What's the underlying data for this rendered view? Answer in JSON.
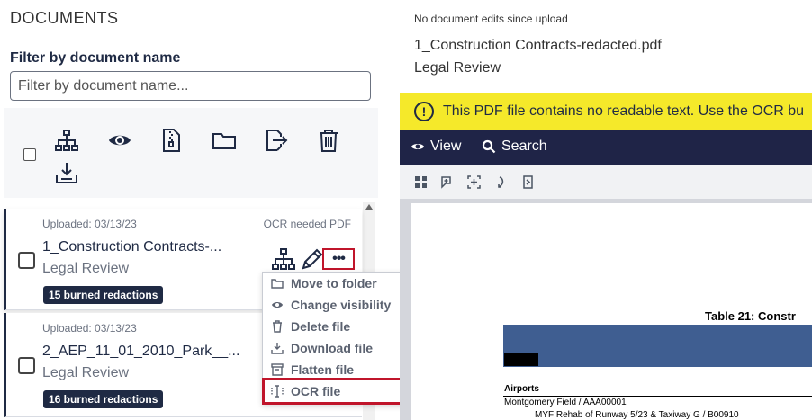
{
  "sidebar": {
    "title": "DOCUMENTS",
    "filter_label": "Filter by document name",
    "filter_placeholder": "Filter by document name...",
    "toolbar_icons": [
      "sitemap-icon",
      "eye-icon",
      "zip-file-icon",
      "folder-icon",
      "export-icon",
      "trash-icon",
      "download-icon"
    ]
  },
  "documents": [
    {
      "uploaded": "Uploaded: 03/13/23",
      "status": "OCR needed PDF",
      "name": "1_Construction Contracts-...",
      "folder": "Legal Review",
      "badge": "15 burned redactions"
    },
    {
      "uploaded": "Uploaded: 03/13/23",
      "name": "2_AEP_11_01_2010_Park__...",
      "folder": "Legal Review",
      "badge": "16 burned redactions"
    }
  ],
  "context_menu": {
    "items": [
      {
        "label": "Move to folder",
        "icon": "folder-icon"
      },
      {
        "label": "Change visibility",
        "icon": "eye-icon"
      },
      {
        "label": "Delete file",
        "icon": "trash-icon"
      },
      {
        "label": "Download file",
        "icon": "download-icon"
      },
      {
        "label": "Flatten file",
        "icon": "flatten-icon"
      },
      {
        "label": "OCR file",
        "icon": "text-cursor-icon"
      }
    ]
  },
  "viewer": {
    "edit_status": "No document edits since upload",
    "file_name": "1_Construction Contracts-redacted.pdf",
    "folder": "Legal Review",
    "warning": "This PDF file contains no readable text. Use the OCR bu",
    "tabs": [
      {
        "label": "View",
        "icon": "eye-icon"
      },
      {
        "label": "Search",
        "icon": "search-icon"
      }
    ],
    "tools": [
      "grid-icon",
      "zoom-icon",
      "select-icon",
      "rotate-icon",
      "page-icon"
    ],
    "page": {
      "table_title": "Table 21: Constr",
      "section": "Airports",
      "row1": "Montgomery Field / AAA00001",
      "row2": "MYF Rehab of Runway 5/23 & Taxiway G / B00910"
    }
  },
  "colors": {
    "navy": "#1f2a44",
    "viewer_bar": "#1f2447",
    "warning_yellow": "#f5e92a",
    "highlight_red": "#c0152b",
    "table_header_blue": "#3f5e91"
  }
}
